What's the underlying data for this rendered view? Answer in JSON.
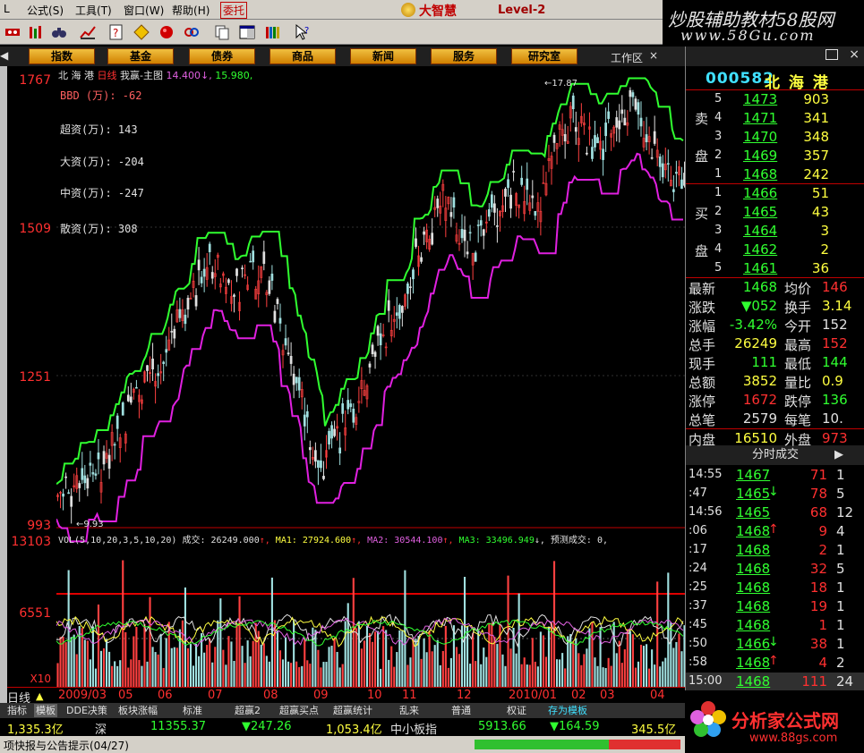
{
  "menu": {
    "items": [
      "公式",
      "工具",
      "窗口",
      "帮助"
    ],
    "items_hotkeys": [
      "(S)",
      "(T)",
      "(W)",
      "(H)"
    ],
    "active": "委托",
    "app_title": "大智慧",
    "app_version": "Level-2"
  },
  "watermark_top": {
    "line1": "炒股辅助教材58股网",
    "line2": "www.58Gu.com"
  },
  "nav": {
    "buttons": [
      "指数",
      "基金",
      "债券",
      "商品",
      "新闻",
      "服务",
      "研究室"
    ],
    "workarea": "工作区"
  },
  "chart": {
    "title_stock": "北 海 港",
    "title_period": "日线",
    "title_main": "我赢-主图",
    "title_v1": "14.400",
    "title_v2": "15.980",
    "bbd_label": "BBD (万): -62",
    "super_label": "超资(万): 143",
    "big_label": "大资(万): -204",
    "mid_label": "中资(万): -247",
    "small_label": "散资(万): 308",
    "high_mark": "17.87",
    "low_mark": "9.93",
    "y_labels": [
      "1767",
      "1509",
      "1251",
      "993"
    ],
    "vol_y_labels": [
      "13103",
      "6551"
    ],
    "vol_unit": "X10",
    "vol_head_left": "VOL(5,10,20,3,5,10,20)",
    "vol_head_1": "成交: 26249.000",
    "vol_head_2": "MA1: 27924.600",
    "vol_head_3": "MA2: 30544.100",
    "vol_head_4": "MA3: 33496.949",
    "vol_head_5": "预测成交: 0,",
    "x_labels": [
      "2009/03",
      "05",
      "06",
      "07",
      "08",
      "09",
      "10",
      "11",
      "12",
      "2010/01",
      "02",
      "03",
      "04"
    ],
    "period_tag": "日线"
  },
  "tabs": [
    "指标",
    "模板",
    "DDE决策",
    "板块涨幅",
    "标准",
    "超赢2",
    "超赢买点",
    "超赢统计",
    "乱来",
    "普通",
    "权证",
    "存为模板"
  ],
  "statusbar": {
    "sh_amount": "1,335.3亿",
    "sz_label": "深",
    "sz_index": "11355.37",
    "sz_change": "▼247.26",
    "sz_amount": "1,053.4亿",
    "smb_label": "中小板指",
    "smb_index": "5913.66",
    "smb_change": "▼164.59",
    "smb_amount": "345.5亿"
  },
  "ticker": "项快报与公告提示(04/27)",
  "quote": {
    "code": "000582",
    "name": "北 海 港",
    "sell": [
      {
        "lvl": "5",
        "price": "1473",
        "vol": "903"
      },
      {
        "lvl": "4",
        "price": "1471",
        "vol": "341"
      },
      {
        "lvl": "3",
        "price": "1470",
        "vol": "348"
      },
      {
        "lvl": "2",
        "price": "1469",
        "vol": "357"
      },
      {
        "lvl": "1",
        "price": "1468",
        "vol": "242"
      }
    ],
    "buy": [
      {
        "lvl": "1",
        "price": "1466",
        "vol": "51"
      },
      {
        "lvl": "2",
        "price": "1465",
        "vol": "43"
      },
      {
        "lvl": "3",
        "price": "1464",
        "vol": "3"
      },
      {
        "lvl": "4",
        "price": "1462",
        "vol": "2"
      },
      {
        "lvl": "5",
        "price": "1461",
        "vol": "36"
      }
    ],
    "sell_label": [
      "卖",
      "盘"
    ],
    "buy_label": [
      "买",
      "盘"
    ],
    "stats": [
      {
        "k1": "最新",
        "v1": "1468",
        "k2": "均价",
        "v2": "146"
      },
      {
        "k1": "涨跌",
        "v1": "▼052",
        "k2": "换手",
        "v2": "3.14"
      },
      {
        "k1": "涨幅",
        "v1": "-3.42%",
        "k2": "今开",
        "v2": "152"
      },
      {
        "k1": "总手",
        "v1": "26249",
        "k2": "最高",
        "v2": "152"
      },
      {
        "k1": "现手",
        "v1": "111",
        "k2": "最低",
        "v2": "144"
      },
      {
        "k1": "总额",
        "v1": "3852",
        "k2": "量比",
        "v2": "0.9"
      },
      {
        "k1": "涨停",
        "v1": "1672",
        "k2": "跌停",
        "v2": "136"
      },
      {
        "k1": "总笔",
        "v1": "2579",
        "k2": "每笔",
        "v2": "10."
      },
      {
        "k1": "内盘",
        "v1": "16510",
        "k2": "外盘",
        "v2": "973"
      }
    ],
    "ticks_header": "分时成交",
    "ticks": [
      {
        "t": "14:55",
        "p": "1467",
        "v": "71",
        "n": "1",
        "dir": "none"
      },
      {
        "t": ":47",
        "p": "1465",
        "v": "78",
        "n": "5",
        "dir": "dn"
      },
      {
        "t": "14:56",
        "p": "1465",
        "v": "68",
        "n": "12",
        "dir": "none"
      },
      {
        "t": ":06",
        "p": "1468",
        "v": "9",
        "n": "4",
        "dir": "up"
      },
      {
        "t": ":17",
        "p": "1468",
        "v": "2",
        "n": "1",
        "dir": "none"
      },
      {
        "t": ":24",
        "p": "1468",
        "v": "32",
        "n": "5",
        "dir": "none"
      },
      {
        "t": ":25",
        "p": "1468",
        "v": "18",
        "n": "1",
        "dir": "none"
      },
      {
        "t": ":37",
        "p": "1468",
        "v": "19",
        "n": "1",
        "dir": "none"
      },
      {
        "t": ":45",
        "p": "1468",
        "v": "1",
        "n": "1",
        "dir": "none"
      },
      {
        "t": ":50",
        "p": "1466",
        "v": "38",
        "n": "1",
        "dir": "dn"
      },
      {
        "t": ":58",
        "p": "1468",
        "v": "4",
        "n": "2",
        "dir": "up"
      },
      {
        "t": "15:00",
        "p": "1468",
        "v": "111",
        "n": "24",
        "dir": "none"
      }
    ]
  },
  "watermark_bot": {
    "line1": "分析家公式网",
    "line2": "www.88gs.com"
  }
}
